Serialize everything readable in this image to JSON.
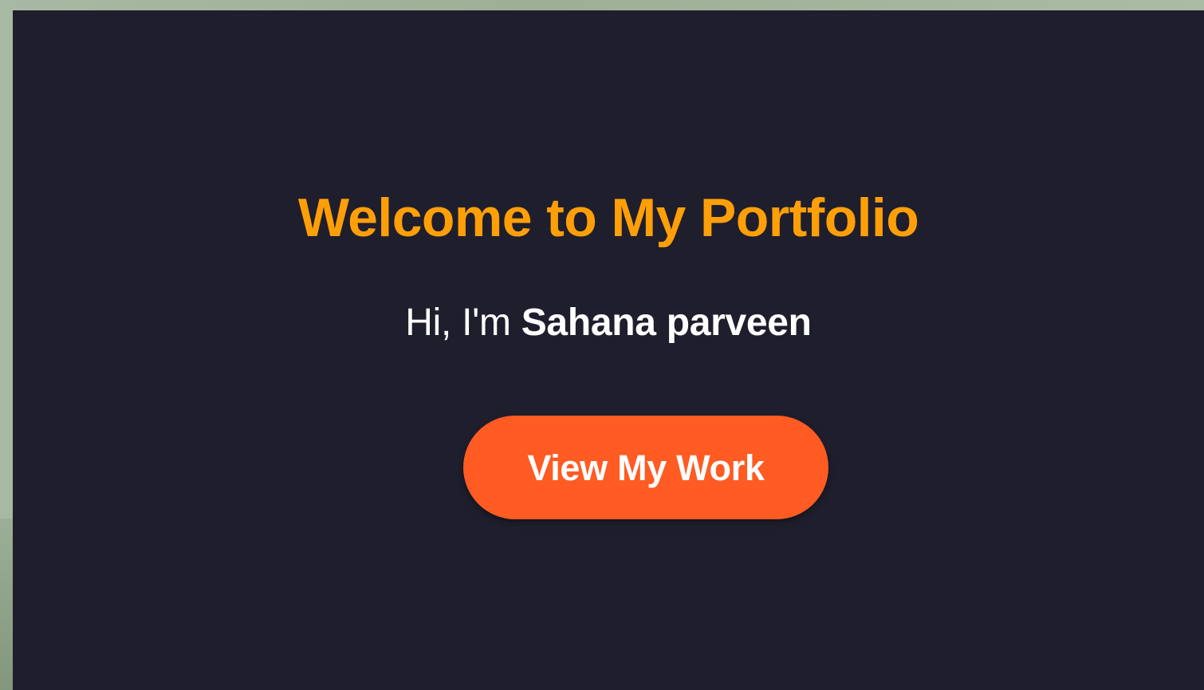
{
  "hero": {
    "title": "Welcome to My Portfolio",
    "intro_prefix": "Hi, I'm",
    "name": "Sahana parveen",
    "cta_label": "View My Work"
  },
  "colors": {
    "background": "#1f1e2d",
    "title": "#ff9f08",
    "intro_text": "#ffffff",
    "button": "#ff5b22",
    "button_text": "#ffffff"
  }
}
